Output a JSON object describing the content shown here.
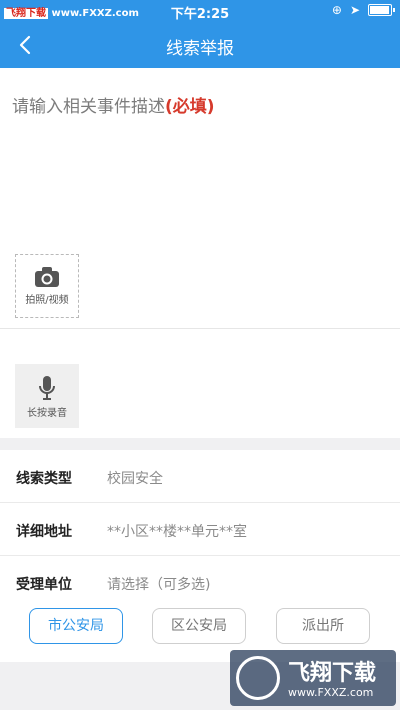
{
  "status_bar": {
    "site_cn": "飞翔下载",
    "site_url": "www.FXXZ.com",
    "time": "下午2:25"
  },
  "nav": {
    "title": "线索举报"
  },
  "description": {
    "placeholder": "请输入相关事件描述",
    "required_tag": "(必填)"
  },
  "media": {
    "photo_label": "拍照/视频",
    "voice_label": "长按录音"
  },
  "form": {
    "rows": [
      {
        "label": "线索类型",
        "value": "校园安全"
      },
      {
        "label": "详细地址",
        "value": "**小区**楼**单元**室"
      },
      {
        "label": "受理单位",
        "value": "请选择（可多选)"
      }
    ],
    "units": [
      {
        "label": "市公安局",
        "selected": true
      },
      {
        "label": "区公安局",
        "selected": false
      },
      {
        "label": "派出所",
        "selected": false
      }
    ]
  },
  "watermark": {
    "brand": "飞翔下载",
    "url": "www.FXXZ.com"
  },
  "colors": {
    "primary": "#2f95e7",
    "required": "#d63a2c"
  }
}
